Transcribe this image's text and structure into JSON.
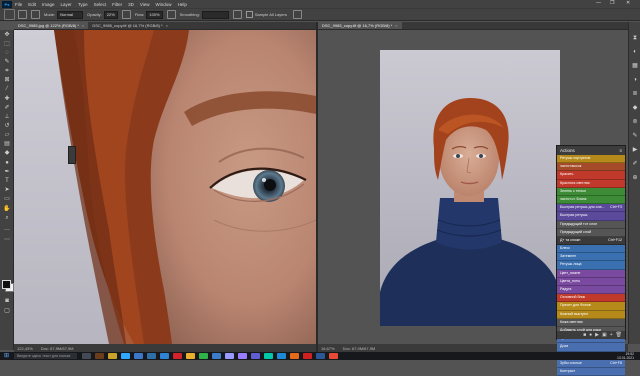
{
  "menubar": {
    "logo": "Ps",
    "items": [
      "File",
      "Edit",
      "Image",
      "Layer",
      "Type",
      "Select",
      "Filter",
      "3D",
      "View",
      "Window",
      "Help"
    ],
    "window_controls": [
      "—",
      "❐",
      "✕"
    ]
  },
  "options": {
    "mode_label": "Mode:",
    "mode_value": "Normal",
    "opacity_label": "Opacity:",
    "opacity_value": "22%",
    "flow_label": "Flow:",
    "flow_value": "100%",
    "smoothing_label": "Smoothing:",
    "sample_label": "Sample All Layers"
  },
  "docs": {
    "left": {
      "tab": "DSC_9985.jpg @ 122% (RGB/8) *",
      "tab_close": "×",
      "zoom": "122,43%",
      "doc_size": "Doc: 67,9M/67,9M"
    },
    "right": {
      "tab": "DSC_9985_copy.tif @ 16,7% (RGB/8) *",
      "tab_close": "×",
      "zoom": "16,67%",
      "doc_size": "Doc: 67,9M/67,9M"
    }
  },
  "actions": {
    "title": "Actions",
    "menu_icon": "≡",
    "rows": [
      {
        "label": "Ретушь портретов",
        "color": "#b58a1a"
      },
      {
        "label": "частот.высок",
        "color": "#a64b2a"
      },
      {
        "label": "Красить",
        "color": "#c0392b"
      },
      {
        "label": "Краснота светлая",
        "color": "#c0392b"
      },
      {
        "label": "Зелень с тенью",
        "color": "#3d8b37"
      },
      {
        "label": "частот.ст. Бланк",
        "color": "#3d8b37"
      },
      {
        "label": "Быстрая ретушь для сла...",
        "key": "Ctrl+F3",
        "color": "#5b4a9c"
      },
      {
        "label": "Быстрая ретушь",
        "color": "#5b4a9c"
      },
      {
        "label": "Предыдущий тот слон",
        "color": "#555555"
      },
      {
        "label": "Предыдущий слой",
        "color": "#555555"
      },
      {
        "label": "Д+ та сложн",
        "key": "Ctrl+F12",
        "color": "#3a3a3a"
      },
      {
        "label": "Блеск",
        "color": "#3a6fb0"
      },
      {
        "label": "Затемнен",
        "color": "#3a6fb0"
      },
      {
        "label": "Ретушь лица",
        "color": "#3a6fb0"
      },
      {
        "label": "Цвет_нижне",
        "color": "#7a4aa0"
      },
      {
        "label": "Цвета_ноты",
        "color": "#7a4aa0"
      },
      {
        "label": "Радуга",
        "color": "#7a4aa0"
      },
      {
        "label": "Основной блик",
        "color": "#c0392b"
      },
      {
        "label": "Пресет для Фонов",
        "color": "#b58a1a"
      },
      {
        "label": "Кожный выстрел",
        "color": "#b58a1a"
      },
      {
        "label": "Кожа светлая",
        "color": "#555555"
      },
      {
        "label": "Добавить слой для кожи",
        "color": "#555555"
      },
      {
        "label": "Зубы",
        "color": "#4a6fb0"
      },
      {
        "label": "Доза",
        "color": "#4a6fb0"
      },
      {
        "label": "Глаза",
        "color": "#4a6fb0"
      },
      {
        "label": "Зубы сочные",
        "key": "Ctrl+F8",
        "color": "#4a6fb0"
      },
      {
        "label": "Контраст",
        "color": "#4a6fb0"
      }
    ],
    "bottom_icons": [
      "■",
      "●",
      "▶",
      "▣",
      "+",
      "🗑"
    ]
  },
  "taskbar": {
    "start_icon": "⊞",
    "search_placeholder": "Введите здесь текст для поиска",
    "apps": [
      {
        "name": "task-view",
        "color": "#444a55"
      },
      {
        "name": "bridge",
        "color": "#6b3d1a"
      },
      {
        "name": "explorer",
        "color": "#c9a227"
      },
      {
        "name": "photoshop",
        "color": "#31a8ff"
      },
      {
        "name": "store",
        "color": "#3b77c6"
      },
      {
        "name": "lightroom",
        "color": "#2f6fa8"
      },
      {
        "name": "mail",
        "color": "#2e83d6"
      },
      {
        "name": "opera",
        "color": "#d2232a"
      },
      {
        "name": "chrome",
        "color": "#e7b12e"
      },
      {
        "name": "whatsapp",
        "color": "#2fb24a"
      },
      {
        "name": "photos",
        "color": "#3d7cc9"
      },
      {
        "name": "after-effects",
        "color": "#9999ff"
      },
      {
        "name": "premiere",
        "color": "#9a7cff"
      },
      {
        "name": "media-encoder",
        "color": "#5e5ed1"
      },
      {
        "name": "audition",
        "color": "#00c8a8"
      },
      {
        "name": "edge",
        "color": "#1e8ad6"
      },
      {
        "name": "firefox",
        "color": "#e66a1a"
      },
      {
        "name": "acrobat",
        "color": "#d02020"
      },
      {
        "name": "word",
        "color": "#2b5797"
      },
      {
        "name": "yandex",
        "color": "#e84a35"
      }
    ],
    "time": "19:52",
    "date": "13.01.2021"
  }
}
